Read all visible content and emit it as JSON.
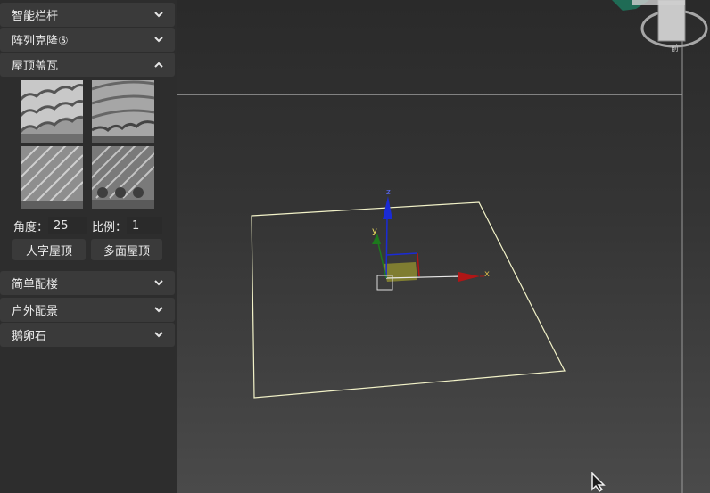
{
  "sidebar": {
    "sections_top": [
      {
        "label": "智能栏杆"
      },
      {
        "label": "阵列克隆⑤"
      },
      {
        "label": "屋顶盖瓦"
      }
    ],
    "roof": {
      "angle_label": "角度：",
      "angle_value": "25",
      "scale_label": "比例：",
      "scale_value": "1",
      "gable_button": "人字屋顶",
      "multi_button": "多面屋顶"
    },
    "sections_bottom": [
      {
        "label": "简单配楼"
      },
      {
        "label": "户外配景"
      },
      {
        "label": "鹅卵石"
      }
    ]
  },
  "viewport": {
    "axis_x": "x",
    "axis_y": "y",
    "axis_z": "z",
    "viewcube_label": "前",
    "colors": {
      "x_axis": "#b01616",
      "y_axis": "#1d7a1d",
      "z_axis": "#1a2bd6",
      "plane": "#f2f2c8"
    }
  }
}
